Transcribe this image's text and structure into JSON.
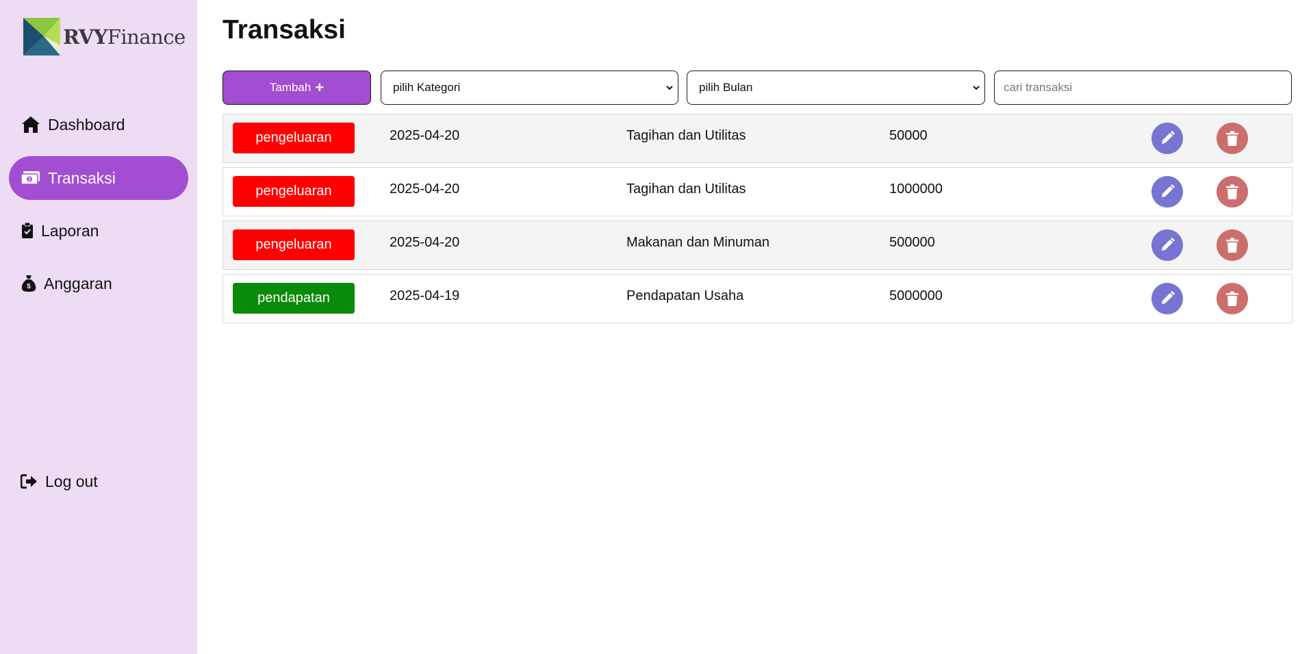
{
  "brand": {
    "name_bold": "RVY",
    "name_regular": "Finance",
    "colors": {
      "logo_dark": "#1d4f6e",
      "logo_green": "#8cc63f",
      "logo_light": "#e6f0d0"
    }
  },
  "sidebar": {
    "items": [
      {
        "label": "Dashboard",
        "icon": "home-icon",
        "active": false
      },
      {
        "label": "Transaksi",
        "icon": "money-icon",
        "active": true
      },
      {
        "label": "Laporan",
        "icon": "clipboard-check-icon",
        "active": false
      },
      {
        "label": "Anggaran",
        "icon": "money-bag-icon",
        "active": false
      }
    ],
    "logout": {
      "label": "Log out",
      "icon": "logout-icon"
    }
  },
  "page": {
    "title": "Transaksi"
  },
  "toolbar": {
    "add_label": "Tambah",
    "add_icon": "plus-icon",
    "kategori_selected": "pilih Kategori",
    "bulan_selected": "pilih Bulan",
    "search_placeholder": "cari transaksi"
  },
  "transactions": [
    {
      "type": "pengeluaran",
      "date": "2025-04-20",
      "category": "Tagihan dan Utilitas",
      "amount": "50000"
    },
    {
      "type": "pengeluaran",
      "date": "2025-04-20",
      "category": "Tagihan dan Utilitas",
      "amount": "1000000"
    },
    {
      "type": "pengeluaran",
      "date": "2025-04-20",
      "category": "Makanan dan Minuman",
      "amount": "500000"
    },
    {
      "type": "pendapatan",
      "date": "2025-04-19",
      "category": "Pendapatan Usaha",
      "amount": "5000000"
    }
  ],
  "colors": {
    "sidebar_bg": "#eedcf5",
    "accent": "#a24dd2",
    "expense": "#ff0000",
    "income": "#0a8a0a",
    "edit": "#7676d2",
    "delete": "#cc6e6e"
  }
}
